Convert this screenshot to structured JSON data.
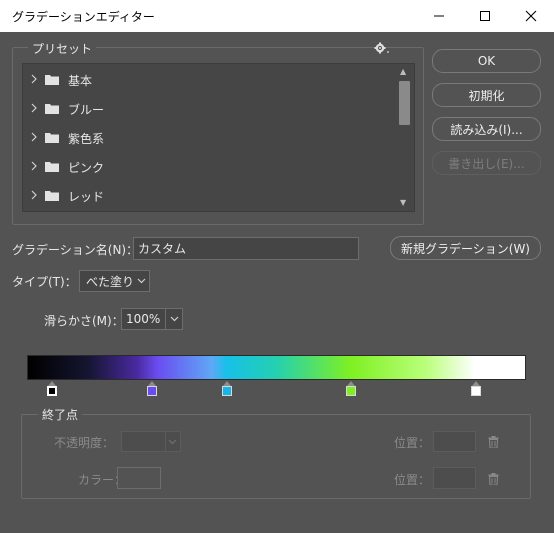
{
  "window": {
    "title": "グラデーションエディター"
  },
  "presets": {
    "legend": "プリセット",
    "items": [
      {
        "label": "基本"
      },
      {
        "label": "ブルー"
      },
      {
        "label": "紫色系"
      },
      {
        "label": "ピンク"
      },
      {
        "label": "レッド"
      }
    ]
  },
  "buttons": {
    "ok": "OK",
    "reset": "初期化",
    "load": "読み込み(I)...",
    "save": "書き出し(E)...",
    "new_gradient": "新規グラデーション(W)"
  },
  "form": {
    "name_label": "グラデーション名(N)：",
    "name_value": "カスタム",
    "type_label": "タイプ(T)：",
    "type_value": "べた塗り",
    "smooth_label": "滑らかさ(M)：",
    "smooth_value": "100%"
  },
  "gradient": {
    "stops": [
      {
        "color": "#000000",
        "position": 0.05,
        "selected": true
      },
      {
        "color": "#6a4cf0",
        "position": 0.25,
        "selected": false
      },
      {
        "color": "#17b6e8",
        "position": 0.4,
        "selected": false
      },
      {
        "color": "#7ff022",
        "position": 0.65,
        "selected": false
      },
      {
        "color": "#ffffff",
        "position": 0.9,
        "selected": false
      }
    ]
  },
  "stops_panel": {
    "legend": "終了点",
    "opacity_label": "不透明度：",
    "location_label_1": "位置：",
    "color_label": "カラー：",
    "location_label_2": "位置："
  },
  "icons": {
    "gear": "gear-icon",
    "folder": "folder-icon",
    "chevron": "chevron-right-icon",
    "trash": "trash-icon"
  }
}
